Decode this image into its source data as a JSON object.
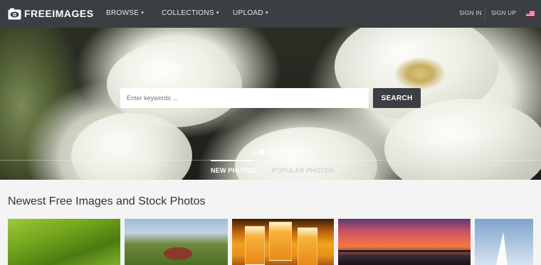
{
  "brand": {
    "name": "FREEIMAGES",
    "icon": "eye-camera-logo"
  },
  "nav": {
    "browse": "BROWSE",
    "collections": "COLLECTIONS",
    "upload": "UPLOAD",
    "caret": "▾",
    "sign_in": "SIGN IN",
    "sign_up": "SIGN UP",
    "flag_icon": "us-flag-icon"
  },
  "hero": {
    "search_placeholder": "Enter keywords ...",
    "search_button": "SEARCH",
    "slides_count": 5,
    "active_slide": 2,
    "tabs": [
      {
        "label": "NEW PHOTOS",
        "active": true
      },
      {
        "label": "POPULAR PHOTOS",
        "active": false
      }
    ]
  },
  "main": {
    "section_title": "Newest Free Images and Stock Photos",
    "thumbnails": [
      {
        "subject": "green grass"
      },
      {
        "subject": "crab on grass"
      },
      {
        "subject": "glasses of beer"
      },
      {
        "subject": "sunset over lake"
      },
      {
        "subject": "white sail"
      }
    ]
  },
  "colors": {
    "nav_bg": "#3b3e42",
    "button_bg": "#3b3e42",
    "page_bg": "#f4f4f4",
    "text_dark": "#333333"
  }
}
